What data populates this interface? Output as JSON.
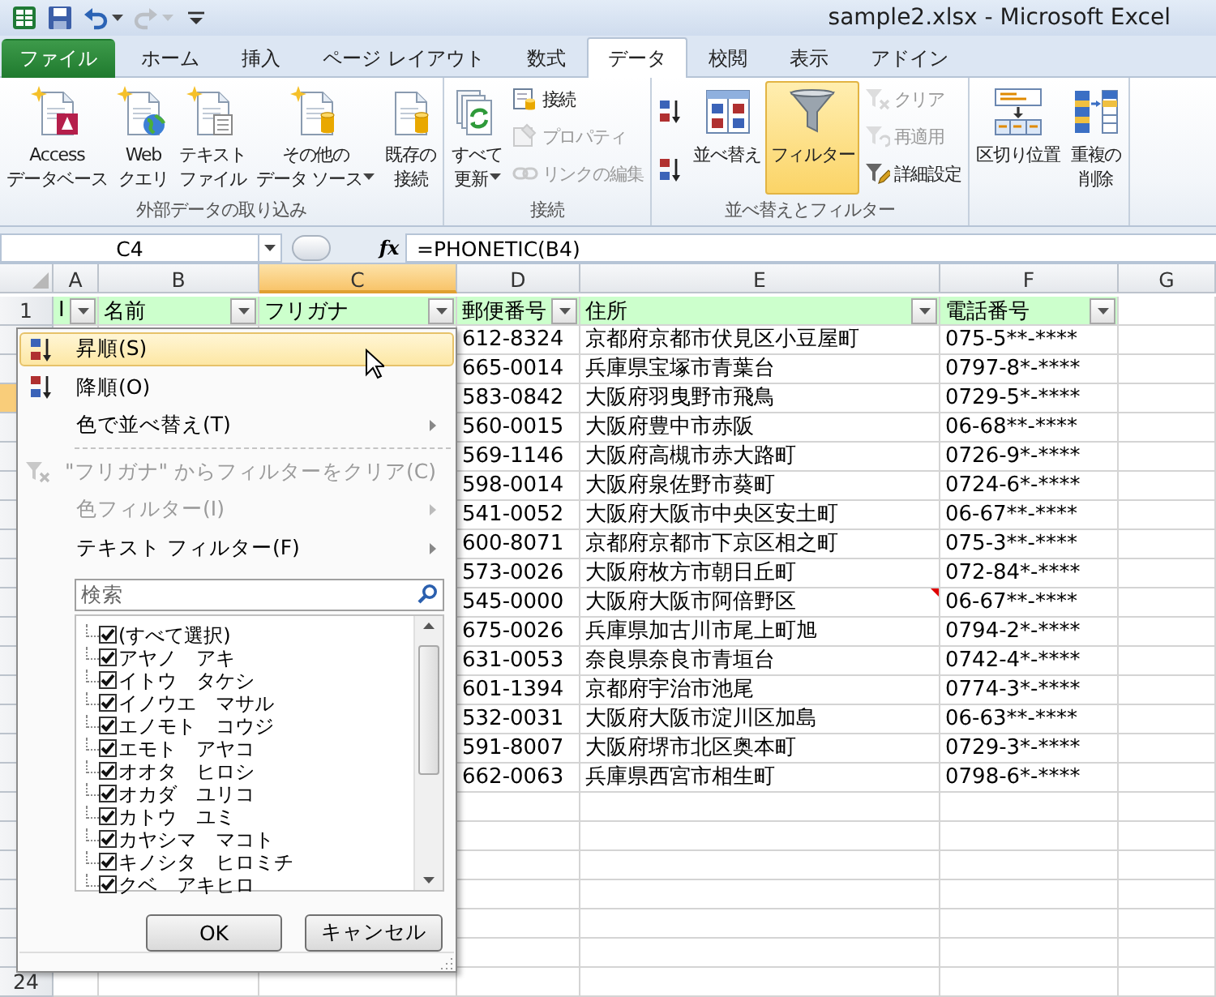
{
  "window": {
    "title": "sample2.xlsx - Microsoft Excel"
  },
  "quick_access": [
    {
      "kind": "logo",
      "disabled": false,
      "menu": false
    },
    {
      "kind": "save",
      "disabled": false,
      "menu": false
    },
    {
      "kind": "undo",
      "disabled": false,
      "menu": true
    },
    {
      "kind": "redo",
      "disabled": true,
      "menu": true
    },
    {
      "kind": "customize",
      "disabled": false,
      "menu": false
    }
  ],
  "tabs": [
    {
      "label": "ファイル",
      "kind": "file",
      "selected": false
    },
    {
      "label": "ホーム",
      "kind": "tab",
      "selected": false
    },
    {
      "label": "挿入",
      "kind": "tab",
      "selected": false
    },
    {
      "label": "ページ レイアウト",
      "kind": "tab",
      "selected": false
    },
    {
      "label": "数式",
      "kind": "tab",
      "selected": false
    },
    {
      "label": "データ",
      "kind": "tab",
      "selected": true
    },
    {
      "label": "校閲",
      "kind": "tab",
      "selected": false
    },
    {
      "label": "表示",
      "kind": "tab",
      "selected": false
    },
    {
      "label": "アドイン",
      "kind": "tab",
      "selected": false
    }
  ],
  "ribbon_groups": [
    {
      "label": "外部データの取り込み",
      "buttons": [
        {
          "kind": "large",
          "lines": [
            "Access",
            "データベース"
          ],
          "menu": false,
          "disabled": false,
          "on": false
        },
        {
          "kind": "large",
          "lines": [
            "Web",
            "クエリ"
          ],
          "menu": false,
          "disabled": false,
          "on": false
        },
        {
          "kind": "large",
          "lines": [
            "テキスト",
            "ファイル"
          ],
          "menu": false,
          "disabled": false,
          "on": false
        },
        {
          "kind": "large",
          "lines": [
            "その他の",
            "データ ソース"
          ],
          "menu": true,
          "disabled": false,
          "on": false
        },
        {
          "kind": "large",
          "lines": [
            "既存の",
            "接続"
          ],
          "menu": false,
          "disabled": false,
          "on": false
        }
      ]
    },
    {
      "label": "接続",
      "buttons": [
        {
          "kind": "large",
          "lines": [
            "すべて",
            "更新"
          ],
          "menu": true,
          "disabled": false,
          "on": false
        },
        {
          "kind": "small",
          "lines": [
            "接続"
          ],
          "menu": false,
          "disabled": false,
          "on": false
        },
        {
          "kind": "small",
          "lines": [
            "プロパティ"
          ],
          "menu": false,
          "disabled": true,
          "on": false
        },
        {
          "kind": "small",
          "lines": [
            "リンクの編集"
          ],
          "menu": false,
          "disabled": true,
          "on": false
        }
      ]
    },
    {
      "label": "並べ替えとフィルター",
      "buttons": [
        {
          "kind": "icon",
          "menu": false,
          "disabled": false,
          "on": false
        },
        {
          "kind": "icon",
          "menu": false,
          "disabled": false,
          "on": false
        },
        {
          "kind": "large",
          "lines": [
            "並べ替え"
          ],
          "menu": false,
          "disabled": false,
          "on": false
        },
        {
          "kind": "large",
          "lines": [
            "フィルター"
          ],
          "menu": false,
          "disabled": false,
          "on": true
        },
        {
          "kind": "small",
          "lines": [
            "クリア"
          ],
          "menu": false,
          "disabled": true,
          "on": false
        },
        {
          "kind": "small",
          "lines": [
            "再適用"
          ],
          "menu": false,
          "disabled": true,
          "on": false
        },
        {
          "kind": "small",
          "lines": [
            "詳細設定"
          ],
          "menu": false,
          "disabled": false,
          "on": false
        }
      ]
    },
    {
      "buttons": [
        {
          "kind": "large",
          "lines": [
            "区切り位置"
          ],
          "menu": false,
          "disabled": false,
          "on": false
        },
        {
          "kind": "large",
          "lines": [
            "重複の",
            "削除"
          ],
          "menu": false,
          "disabled": false,
          "on": false
        }
      ]
    }
  ],
  "formula_bar": {
    "name_box": "C4",
    "function_label": "fx",
    "formula": "=PHONETIC(B4)"
  },
  "sheet": {
    "columns": [
      {
        "label": "A",
        "selected": false
      },
      {
        "label": "B",
        "selected": false
      },
      {
        "label": "C",
        "selected": true
      },
      {
        "label": "D",
        "selected": false
      },
      {
        "label": "E",
        "selected": false
      },
      {
        "label": "F",
        "selected": false
      },
      {
        "label": "G",
        "selected": false
      }
    ],
    "header_row": {
      "number": "1",
      "cells": [
        {
          "text": "I",
          "filter": true
        },
        {
          "text": "名前",
          "filter": true
        },
        {
          "text": "フリガナ",
          "filter": true
        },
        {
          "text": "郵便番号",
          "filter": true
        },
        {
          "text": "住所",
          "filter": true
        },
        {
          "text": "電話番号",
          "filter": true
        }
      ]
    },
    "rows": [
      {
        "selected": false,
        "comment": false,
        "postal": "612-8324",
        "address": "京都府京都市伏見区小豆屋町",
        "phone": "075-5**-****"
      },
      {
        "selected": false,
        "comment": false,
        "postal": "665-0014",
        "address": "兵庫県宝塚市青葉台",
        "phone": "0797-8*-****"
      },
      {
        "selected": true,
        "comment": false,
        "postal": "583-0842",
        "address": "大阪府羽曳野市飛鳥",
        "phone": "0729-5*-****"
      },
      {
        "selected": false,
        "comment": false,
        "postal": "560-0015",
        "address": "大阪府豊中市赤阪",
        "phone": "06-68**-****"
      },
      {
        "selected": false,
        "comment": false,
        "postal": "569-1146",
        "address": "大阪府高槻市赤大路町",
        "phone": "0726-9*-****"
      },
      {
        "selected": false,
        "comment": false,
        "postal": "598-0014",
        "address": "大阪府泉佐野市葵町",
        "phone": "0724-6*-****"
      },
      {
        "selected": false,
        "comment": false,
        "postal": "541-0052",
        "address": "大阪府大阪市中央区安土町",
        "phone": "06-67**-****"
      },
      {
        "selected": false,
        "comment": false,
        "postal": "600-8071",
        "address": "京都府京都市下京区相之町",
        "phone": "075-3**-****"
      },
      {
        "selected": false,
        "comment": false,
        "postal": "573-0026",
        "address": "大阪府枚方市朝日丘町",
        "phone": "072-84*-****"
      },
      {
        "selected": false,
        "comment": true,
        "postal": "545-0000",
        "address": "大阪府大阪市阿倍野区",
        "phone": "06-67**-****"
      },
      {
        "selected": false,
        "comment": false,
        "postal": "675-0026",
        "address": "兵庫県加古川市尾上町旭",
        "phone": "0794-2*-****"
      },
      {
        "selected": false,
        "comment": false,
        "postal": "631-0053",
        "address": "奈良県奈良市青垣台",
        "phone": "0742-4*-****"
      },
      {
        "selected": false,
        "comment": false,
        "postal": "601-1394",
        "address": "京都府宇治市池尾",
        "phone": "0774-3*-****"
      },
      {
        "selected": false,
        "comment": false,
        "postal": "532-0031",
        "address": "大阪府大阪市淀川区加島",
        "phone": "06-63**-****"
      },
      {
        "selected": false,
        "comment": false,
        "postal": "591-8007",
        "address": "大阪府堺市北区奥本町",
        "phone": "0729-3*-****"
      },
      {
        "selected": false,
        "comment": false,
        "postal": "662-0063",
        "address": "兵庫県西宮市相生町",
        "phone": "0798-6*-****"
      }
    ],
    "last_row_number": "24"
  },
  "filter_menu": {
    "items": [
      {
        "kind": "sort-asc",
        "label": "昇順(S)",
        "disabled": false,
        "highlighted": true,
        "submenu": false
      },
      {
        "kind": "sort-desc",
        "label": "降順(O)",
        "disabled": false,
        "highlighted": false,
        "submenu": false
      },
      {
        "kind": "plain",
        "label": "色で並べ替え(T)",
        "disabled": false,
        "highlighted": false,
        "submenu": true
      },
      {
        "kind": "separator"
      },
      {
        "kind": "clear-filter",
        "label": "\"フリガナ\" からフィルターをクリア(C)",
        "disabled": true,
        "highlighted": false,
        "submenu": false
      },
      {
        "kind": "plain",
        "label": "色フィルター(I)",
        "disabled": true,
        "highlighted": false,
        "submenu": true
      },
      {
        "kind": "plain",
        "label": "テキスト フィルター(F)",
        "disabled": false,
        "highlighted": false,
        "submenu": true
      }
    ],
    "search": {
      "placeholder": "検索"
    },
    "values": [
      {
        "label": "(すべて選択)",
        "checked": true
      },
      {
        "label": "アヤノ　アキ",
        "checked": true
      },
      {
        "label": "イトウ　タケシ",
        "checked": true
      },
      {
        "label": "イノウエ　マサル",
        "checked": true
      },
      {
        "label": "エノモト　コウジ",
        "checked": true
      },
      {
        "label": "エモト　アヤコ",
        "checked": true
      },
      {
        "label": "オオタ　ヒロシ",
        "checked": true
      },
      {
        "label": "オカダ　ユリコ",
        "checked": true
      },
      {
        "label": "カトウ　ユミ",
        "checked": true
      },
      {
        "label": "カヤシマ　マコト",
        "checked": true
      },
      {
        "label": "キノシタ　ヒロミチ",
        "checked": true
      },
      {
        "label": "クベ　アキヒロ",
        "checked": true
      }
    ],
    "buttons": [
      "OK",
      "キャンセル"
    ]
  }
}
